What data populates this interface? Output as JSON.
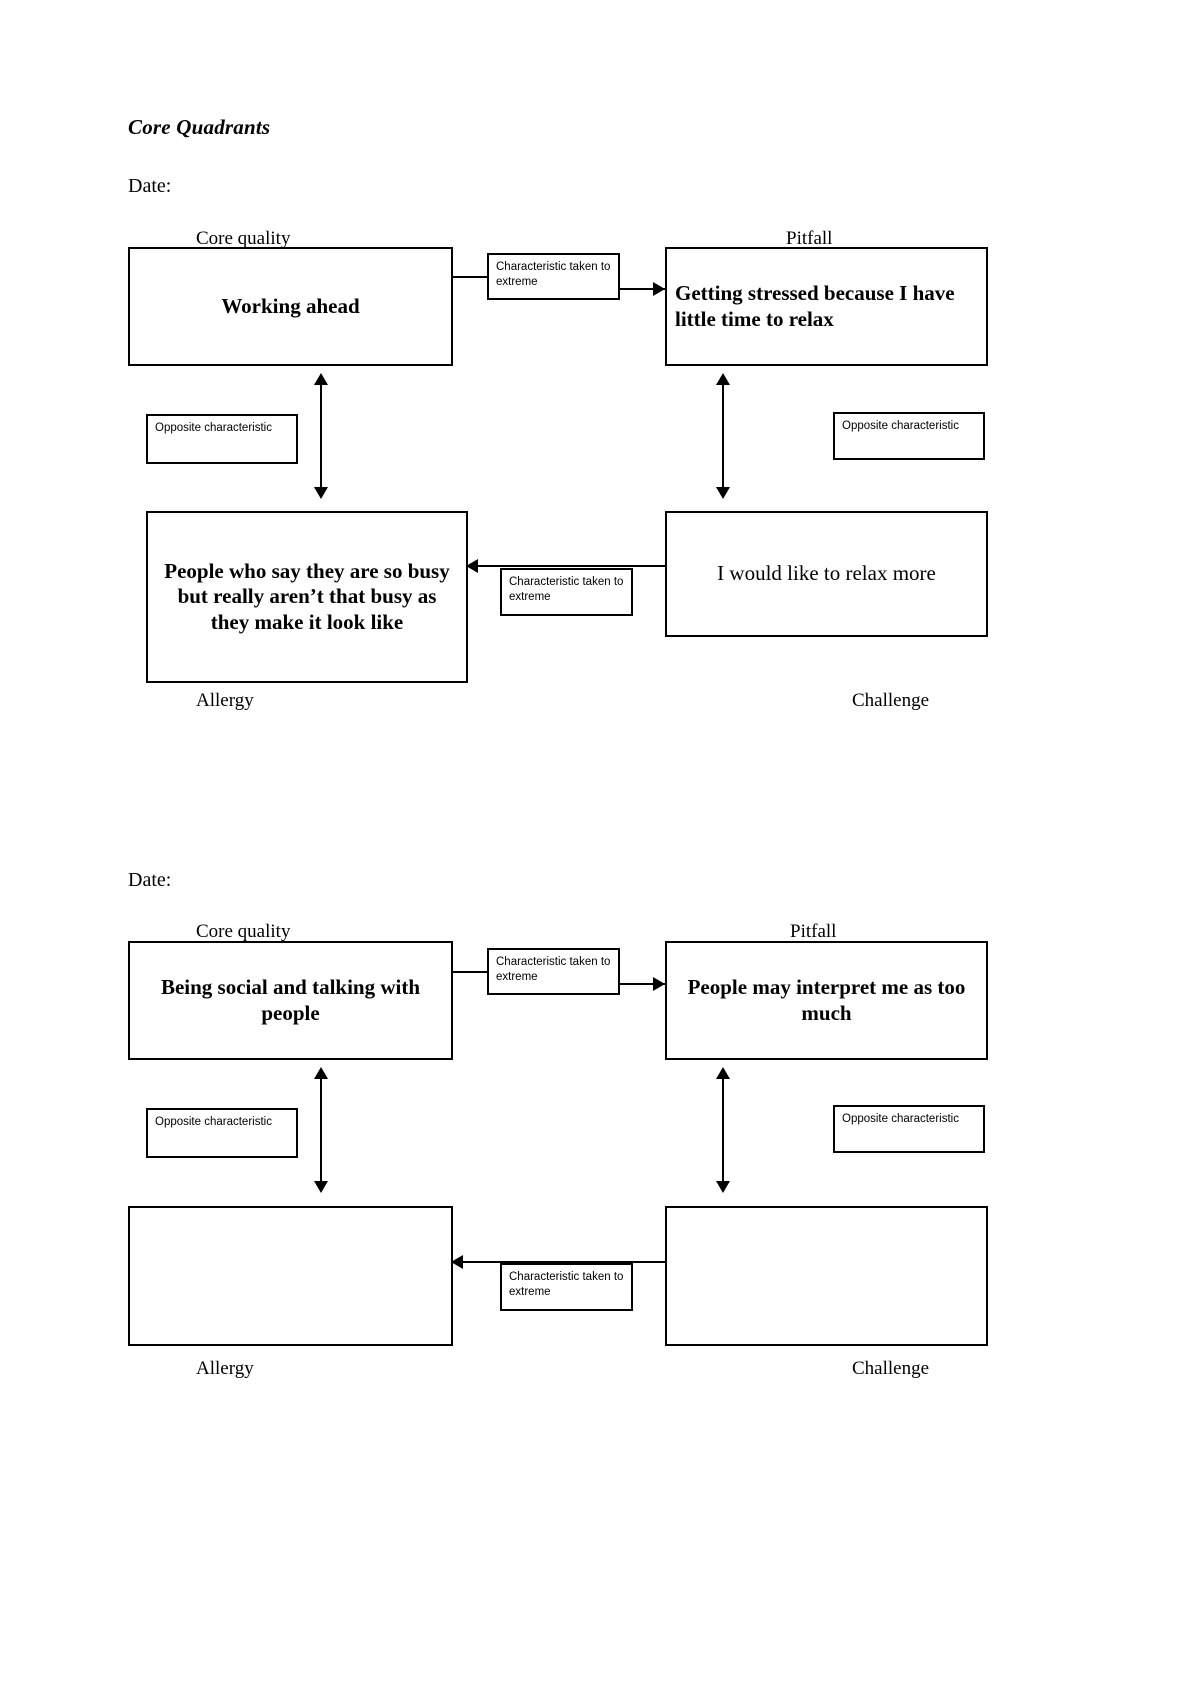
{
  "document": {
    "title": "Core Quadrants"
  },
  "labels": {
    "date": "Date:",
    "core_quality": "Core quality",
    "pitfall": "Pitfall",
    "allergy": "Allergy",
    "challenge": "Challenge",
    "characteristic_taken_to_extreme": "Characteristic taken to extreme",
    "opposite_characteristic": "Opposite characteristic"
  },
  "diagrams": [
    {
      "date_value": "",
      "core_quality": "Working ahead",
      "pitfall": "Getting stressed because I have little time to relax",
      "allergy": "People who say they are so busy but really aren’t that busy as they make it look like",
      "challenge": "I would like to relax more"
    },
    {
      "date_value": "",
      "core_quality": "Being social and talking with people",
      "pitfall": "People may interpret me as too much",
      "allergy": "",
      "challenge": ""
    }
  ]
}
